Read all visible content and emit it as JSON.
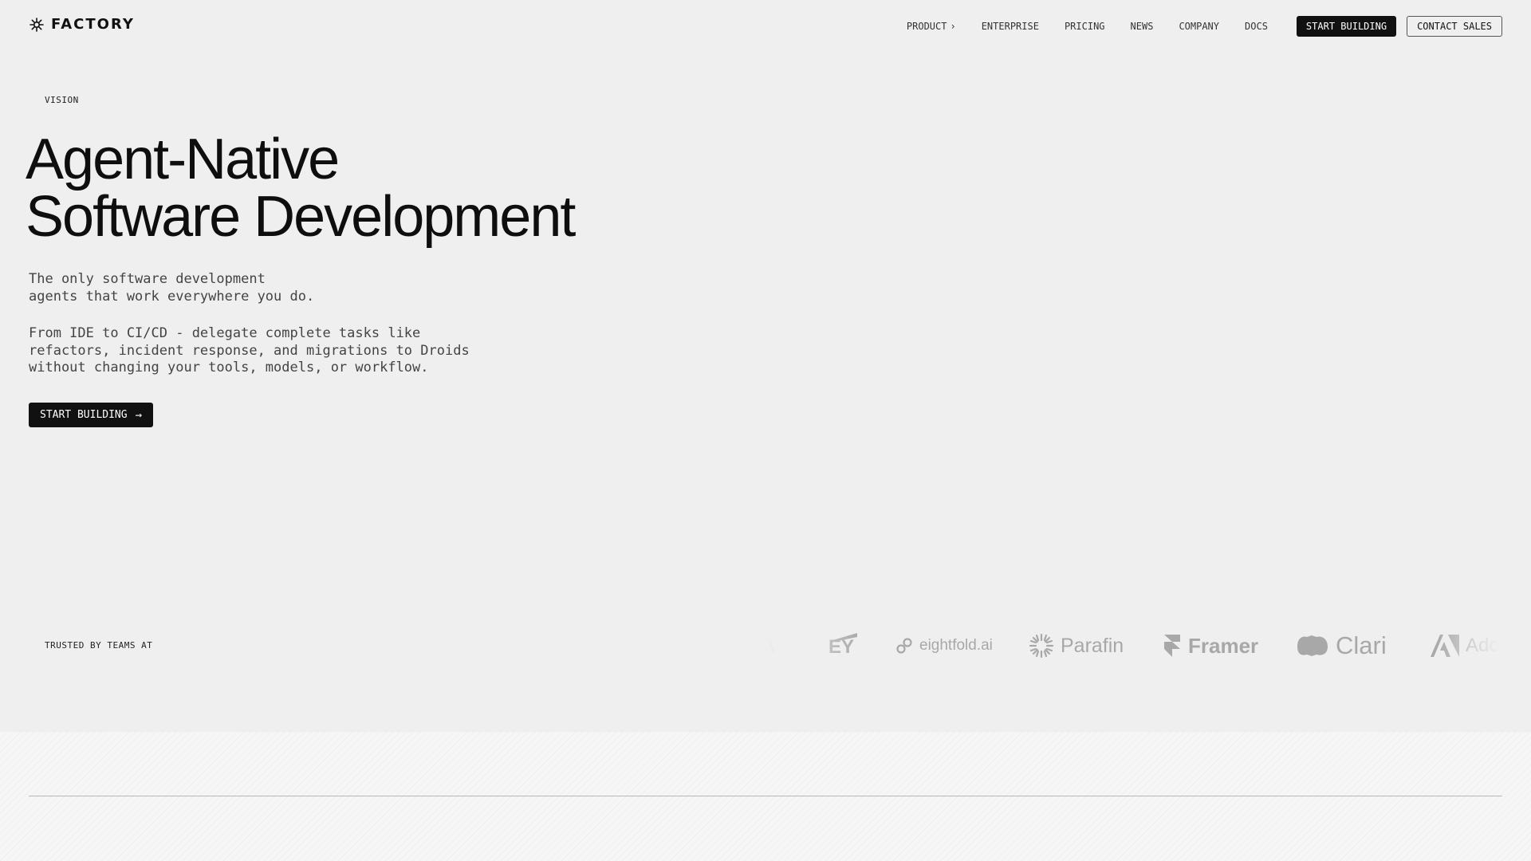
{
  "header": {
    "logo_text": "FACTORY",
    "nav": [
      {
        "label": "PRODUCT",
        "has_chevron": true
      },
      {
        "label": "ENTERPRISE"
      },
      {
        "label": "PRICING"
      },
      {
        "label": "NEWS"
      },
      {
        "label": "COMPANY"
      },
      {
        "label": "DOCS"
      }
    ],
    "primary_cta": "START BUILDING",
    "secondary_cta": "CONTACT SALES"
  },
  "hero": {
    "eyebrow": "VISION",
    "title_lines": [
      "Agent-Native",
      "Software Development"
    ],
    "paragraph1_lines": [
      "The only software development",
      "agents that work everywhere you do."
    ],
    "paragraph2_lines": [
      "From IDE to CI/CD - delegate complete tasks like",
      "refactors, incident response, and migrations to Droids",
      "without changing your tools, models, or workflow."
    ],
    "cta_label": "START BUILDING",
    "cta_icon": "arrow-right-icon"
  },
  "trusted": {
    "label": "TRUSTED BY TEAMS AT",
    "logos": [
      "EY",
      "eightfold.ai",
      "Parafin",
      "Framer",
      "Clari",
      "Adobe"
    ]
  },
  "colors": {
    "background": "#efefef",
    "text": "#111111",
    "muted_text": "#444444",
    "logo_gray": "#a8a8a8",
    "button_dark": "#111111"
  }
}
